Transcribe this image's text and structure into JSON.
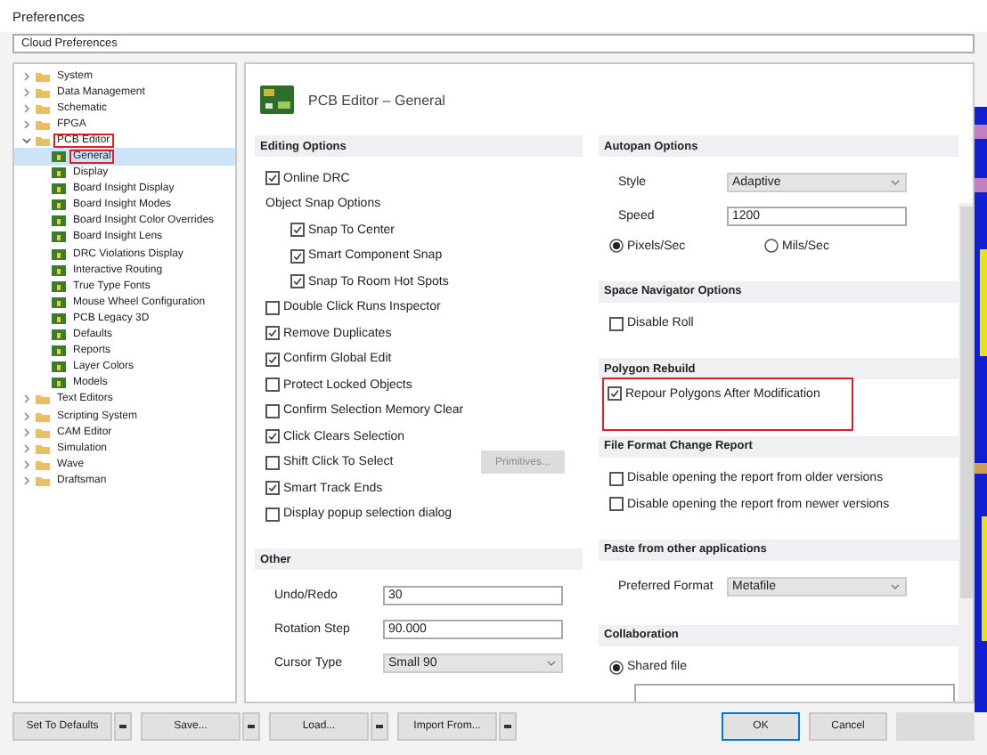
{
  "window": {
    "title": "Preferences"
  },
  "profile_select": {
    "value": "Cloud Preferences"
  },
  "tree": [
    {
      "label": "System",
      "expanded": false,
      "selected": false,
      "highlighted": false
    },
    {
      "label": "Data Management",
      "expanded": false,
      "selected": false,
      "highlighted": false
    },
    {
      "label": "Schematic",
      "expanded": false,
      "selected": false,
      "highlighted": false
    },
    {
      "label": "FPGA",
      "expanded": false,
      "selected": false,
      "highlighted": false
    },
    {
      "label": "PCB Editor",
      "expanded": true,
      "selected": false,
      "highlighted": true,
      "children": [
        {
          "label": "General",
          "selected": true,
          "highlighted": true
        },
        {
          "label": "Display",
          "selected": false,
          "highlighted": false
        },
        {
          "label": "Board Insight Display",
          "selected": false,
          "highlighted": false
        },
        {
          "label": "Board Insight Modes",
          "selected": false,
          "highlighted": false
        },
        {
          "label": "Board Insight Color Overrides",
          "selected": false,
          "highlighted": false
        },
        {
          "label": "Board Insight Lens",
          "selected": false,
          "highlighted": false
        },
        {
          "label": "DRC Violations Display",
          "selected": false,
          "highlighted": false
        },
        {
          "label": "Interactive Routing",
          "selected": false,
          "highlighted": false
        },
        {
          "label": "True Type Fonts",
          "selected": false,
          "highlighted": false
        },
        {
          "label": "Mouse Wheel Configuration",
          "selected": false,
          "highlighted": false
        },
        {
          "label": "PCB Legacy 3D",
          "selected": false,
          "highlighted": false
        },
        {
          "label": "Defaults",
          "selected": false,
          "highlighted": false
        },
        {
          "label": "Reports",
          "selected": false,
          "highlighted": false
        },
        {
          "label": "Layer Colors",
          "selected": false,
          "highlighted": false
        },
        {
          "label": "Models",
          "selected": false,
          "highlighted": false
        }
      ]
    },
    {
      "label": "Text Editors",
      "expanded": false,
      "selected": false,
      "highlighted": false
    },
    {
      "label": "Scripting System",
      "expanded": false,
      "selected": false,
      "highlighted": false
    },
    {
      "label": "CAM Editor",
      "expanded": false,
      "selected": false,
      "highlighted": false
    },
    {
      "label": "Simulation",
      "expanded": false,
      "selected": false,
      "highlighted": false
    },
    {
      "label": "Wave",
      "expanded": false,
      "selected": false,
      "highlighted": false
    },
    {
      "label": "Draftsman",
      "expanded": false,
      "selected": false,
      "highlighted": false
    }
  ],
  "page_title": "PCB Editor – General",
  "columns": [
    [
      {
        "title": "Editing Options",
        "rows": [
          {
            "kind": "check",
            "label": "Online DRC",
            "checked": true
          },
          {
            "kind": "label",
            "label": "Object Snap Options",
            "children": [
              {
                "kind": "check",
                "label": "Snap To Center",
                "checked": true
              },
              {
                "kind": "check",
                "label": "Smart Component Snap",
                "checked": true
              },
              {
                "kind": "check",
                "label": "Snap To Room Hot Spots",
                "checked": true
              }
            ]
          },
          {
            "kind": "check",
            "label": "Double Click Runs Inspector",
            "checked": false
          },
          {
            "kind": "check",
            "label": "Remove Duplicates",
            "checked": true
          },
          {
            "kind": "check",
            "label": "Confirm Global Edit",
            "checked": true
          },
          {
            "kind": "check",
            "label": "Protect Locked Objects",
            "checked": false
          },
          {
            "kind": "check",
            "label": "Confirm Selection Memory Clear",
            "checked": false
          },
          {
            "kind": "check",
            "label": "Click Clears Selection",
            "checked": true
          },
          {
            "kind": "check",
            "label": "Shift Click To Select",
            "checked": false,
            "button": {
              "label": "Primitives...",
              "disabled": true
            }
          },
          {
            "kind": "check",
            "label": "Smart Track Ends",
            "checked": true
          },
          {
            "kind": "check",
            "label": "Display popup selection dialog",
            "checked": false
          }
        ]
      },
      {
        "title": "Other",
        "rows": [
          {
            "kind": "input",
            "label": "Undo/Redo",
            "value": "30"
          },
          {
            "kind": "input",
            "label": "Rotation Step",
            "value": "90.000"
          },
          {
            "kind": "select",
            "label": "Cursor Type",
            "value": "Small 90"
          }
        ]
      }
    ],
    [
      {
        "title": "Autopan Options",
        "rows": [
          {
            "kind": "select",
            "label": "Style",
            "value": "Adaptive"
          },
          {
            "kind": "input",
            "label": "Speed",
            "value": "1200"
          },
          {
            "kind": "radios",
            "options": [
              {
                "label": "Pixels/Sec",
                "selected": true
              },
              {
                "label": "Mils/Sec",
                "selected": false
              }
            ]
          }
        ]
      },
      {
        "title": "Space Navigator Options",
        "rows": [
          {
            "kind": "check",
            "label": "Disable Roll",
            "checked": false
          }
        ]
      },
      {
        "title": "Polygon Rebuild",
        "rows": [
          {
            "kind": "check",
            "label": "Repour Polygons After Modification",
            "checked": true,
            "highlighted": true
          }
        ]
      },
      {
        "title": "File Format Change Report",
        "rows": [
          {
            "kind": "check",
            "label": "Disable opening the report from older versions",
            "checked": false
          },
          {
            "kind": "check",
            "label": "Disable opening the report from newer versions",
            "checked": false
          }
        ]
      },
      {
        "title": "Paste from other applications",
        "rows": [
          {
            "kind": "select",
            "label": "Preferred Format",
            "value": "Metafile"
          }
        ]
      },
      {
        "title": "Collaboration",
        "rows": [
          {
            "kind": "radios",
            "options": [
              {
                "label": "Shared file",
                "selected": true
              }
            ]
          },
          {
            "kind": "field"
          }
        ]
      }
    ]
  ],
  "left_buttons": [
    {
      "label": "Set To Defaults",
      "dropdown": true
    },
    {
      "label": "Save...",
      "dropdown": true
    },
    {
      "label": "Load...",
      "dropdown": true
    },
    {
      "label": "Import From...",
      "dropdown": true
    }
  ],
  "right_buttons": [
    {
      "label": "OK",
      "default": true,
      "disabled": false
    },
    {
      "label": "Cancel",
      "default": false,
      "disabled": false
    },
    {
      "default": false,
      "disabled": true
    }
  ]
}
